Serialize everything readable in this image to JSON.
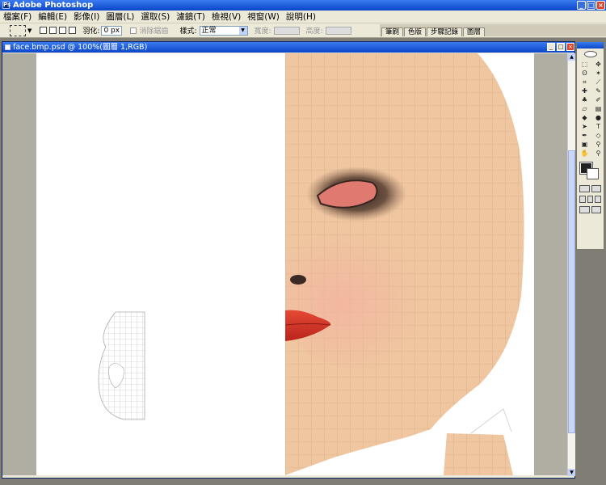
{
  "app": {
    "title": "Adobe Photoshop",
    "title_icon": "photoshop-icon",
    "window_buttons": [
      "minimize",
      "maximize",
      "close"
    ]
  },
  "menu": [
    "檔案(F)",
    "編輯(E)",
    "影像(I)",
    "圖層(L)",
    "選取(S)",
    "濾鏡(T)",
    "檢視(V)",
    "視窗(W)",
    "說明(H)"
  ],
  "options_bar": {
    "feather_label": "羽化:",
    "feather_value": "0 px",
    "antialias_label": "消除鋸齒",
    "style_label": "樣式:",
    "style_value": "正常",
    "width_label": "寬度:",
    "height_label": "高度:"
  },
  "palette_well_tabs": [
    "筆刷",
    "色版",
    "步驟記錄",
    "圖層"
  ],
  "document": {
    "title": "face.bmp.psd @ 100%(圖層 1,RGB)"
  },
  "colors": {
    "titlebar": "#0a46c8",
    "skin": "#efc6a0",
    "lips": "#d9302a",
    "eye": "#e07a70"
  }
}
